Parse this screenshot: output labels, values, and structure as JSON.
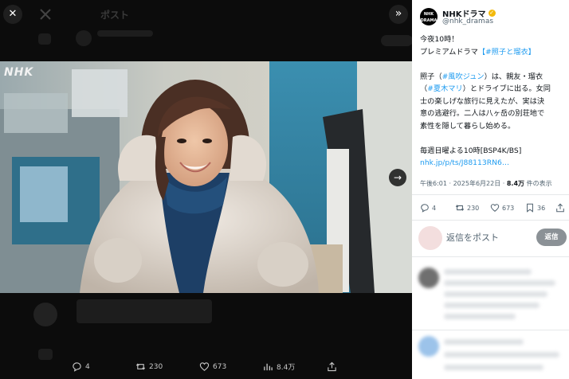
{
  "viewer": {
    "close_glyph": "✕",
    "expand_glyph": "»",
    "next_glyph": "→",
    "watermark": "NHK",
    "background_header": "ポスト",
    "actions": [
      {
        "icon": "reply-icon",
        "count": "4"
      },
      {
        "icon": "repost-icon",
        "count": "230"
      },
      {
        "icon": "like-icon",
        "count": "673"
      },
      {
        "icon": "views-icon",
        "count": "8.4万"
      },
      {
        "icon": "share-icon",
        "count": ""
      }
    ]
  },
  "tweet": {
    "account_name": "NHKドラマ",
    "handle": "@nhk_dramas",
    "avatar_text_top": "NHK",
    "avatar_text_bottom": "DRAMA",
    "line1": "今夜10時！",
    "line2_prefix": "プレミアムドラマ",
    "line2_tag": "【#照子と瑠衣】",
    "line3_prefix": "照子（",
    "line3_tag": "#風吹ジュン",
    "line3_suffix": "）は、親友・瑠衣",
    "line4_prefix": "（",
    "line4_tag": "#夏木マリ",
    "line4_suffix": "）とドライブに出る。女同",
    "line5": "士の楽しげな旅行に見えたが、実は決",
    "line6": "意の逃避行。二人は八ヶ岳の別荘地で",
    "line7": "素性を隠して暮らし始める。",
    "line8": "毎週日曜よる10時[BSP4K/BS]",
    "link": "nhk.jp/p/ts/J88113RN6…",
    "time": "午後6:01 · 2025年6月22日 · ",
    "views_count": "8.4万",
    "views_label": " 件の表示"
  },
  "stats": {
    "replies": "4",
    "reposts": "230",
    "likes": "673",
    "bookmarks": "36"
  },
  "reply": {
    "placeholder": "返信をポスト",
    "button": "返信"
  },
  "colors": {
    "accent": "#1d9bf0",
    "verified": "#f3b90b",
    "viewer_bg": "#0c0c0c"
  }
}
